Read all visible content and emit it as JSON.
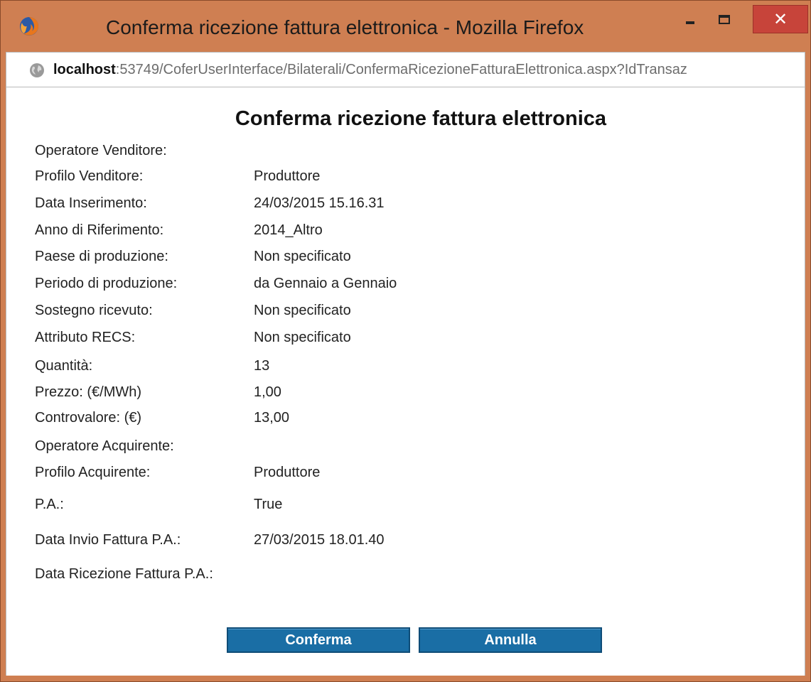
{
  "window": {
    "title": "Conferma ricezione fattura elettronica - Mozilla Firefox",
    "close_symbol": "✕"
  },
  "address_bar": {
    "host": "localhost",
    "path": ":53749/CoferUserInterface/Bilaterali/ConfermaRicezioneFatturaElettronica.aspx?IdTransaz"
  },
  "page": {
    "title": "Conferma ricezione fattura elettronica",
    "fields": [
      {
        "label": "Operatore Venditore:",
        "value": ""
      },
      {
        "label": "Profilo Venditore:",
        "value": "Produttore"
      },
      {
        "label": "Data Inserimento:",
        "value": "24/03/2015 15.16.31"
      },
      {
        "label": "Anno di Riferimento:",
        "value": "2014_Altro"
      },
      {
        "label": "Paese di produzione:",
        "value": "Non specificato"
      },
      {
        "label": "Periodo di produzione:",
        "value": "da Gennaio a Gennaio"
      },
      {
        "label": "Sostegno ricevuto:",
        "value": "Non specificato"
      },
      {
        "label": "Attributo RECS:",
        "value": "Non specificato"
      },
      {
        "label": "Quantità:",
        "value": "13"
      },
      {
        "label": "Prezzo: (€/MWh)",
        "value": "1,00"
      },
      {
        "label": "Controvalore: (€)",
        "value": "13,00"
      },
      {
        "label": "Operatore Acquirente:",
        "value": ""
      },
      {
        "label": "Profilo Acquirente:",
        "value": "Produttore"
      },
      {
        "label": "P.A.:",
        "value": "True"
      },
      {
        "label": "Data Invio Fattura P.A.:",
        "value": "27/03/2015 18.01.40"
      },
      {
        "label": "Data Ricezione Fattura P.A.:",
        "value": ""
      }
    ],
    "buttons": {
      "confirm": "Conferma",
      "cancel": "Annulla"
    }
  },
  "colors": {
    "window_frame": "#cf7f52",
    "button_bg": "#1a6ea5",
    "close_button": "#c7443a"
  },
  "icons": {
    "app": "firefox-icon",
    "site": "globe-icon",
    "minimize": "minimize-icon",
    "maximize": "maximize-icon",
    "close": "close-icon"
  }
}
